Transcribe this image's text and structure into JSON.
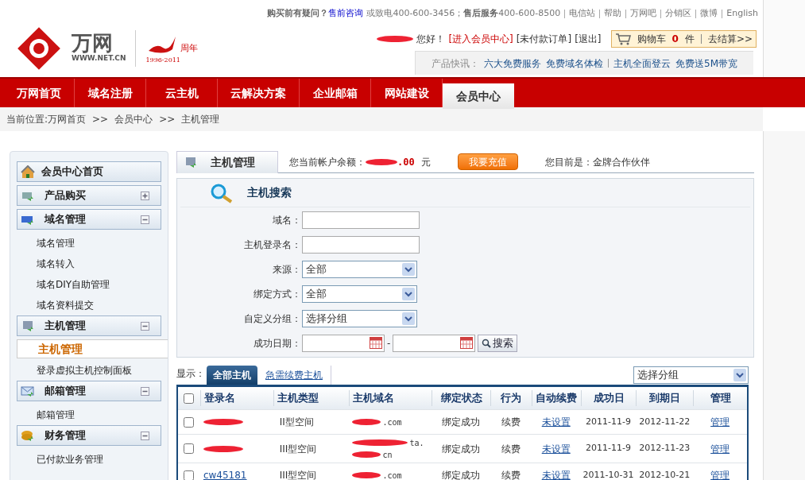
{
  "header": {
    "help_prefix": "购买前有疑问？",
    "presale": "售前咨询",
    "phone1": "或致电400-600-3456；",
    "aftersale": "售后服务",
    "phone2": "400-600-8500",
    "top_links": [
      "电信站",
      "帮助",
      "万网吧",
      "分销区",
      "微博",
      "English"
    ],
    "logo_text": "万网",
    "logo_url": "WWW.NET.CN",
    "anniv_years": "1996-2011",
    "anniv_label": "周年",
    "greeting": "您好！",
    "member_link": "[进入会员中心]",
    "unpaid": "[未付款订单]",
    "logout": "[退出]",
    "cart_label": "购物车",
    "cart_count": "0",
    "cart_unit": "件",
    "checkout": "去结算>>",
    "news_label": "产品快讯：",
    "news": [
      "六大免费服务",
      "免费域名体检",
      "主机全面登云",
      "免费送5M带宽"
    ]
  },
  "nav": [
    {
      "label": "万网首页",
      "selected": false
    },
    {
      "label": "域名注册",
      "selected": false
    },
    {
      "label": "云主机",
      "selected": false
    },
    {
      "label": "云解决方案",
      "selected": false
    },
    {
      "label": "企业邮箱",
      "selected": false
    },
    {
      "label": "网站建设",
      "selected": false
    },
    {
      "label": "会员中心",
      "selected": true
    }
  ],
  "breadcrumb": [
    "当前位置:万网首页",
    ">>",
    "会员中心",
    ">>",
    "主机管理"
  ],
  "sidebar": [
    {
      "label": "会员中心首页",
      "kind": "link"
    },
    {
      "label": "产品购买",
      "kind": "group",
      "expanded": false
    },
    {
      "label": "域名管理",
      "kind": "group",
      "expanded": true,
      "children": [
        {
          "label": "域名管理",
          "selected": false
        },
        {
          "label": "域名转入",
          "selected": false
        },
        {
          "label": "域名DIY自助管理",
          "selected": false
        },
        {
          "label": "域名资料提交",
          "selected": false
        }
      ]
    },
    {
      "label": "主机管理",
      "kind": "group",
      "expanded": true,
      "children": [
        {
          "label": "主机管理",
          "selected": true
        },
        {
          "label": "登录虚拟主机控制面板",
          "selected": false
        }
      ]
    },
    {
      "label": "邮箱管理",
      "kind": "group",
      "expanded": true,
      "children": [
        {
          "label": "邮箱管理",
          "selected": false
        }
      ]
    },
    {
      "label": "财务管理",
      "kind": "group",
      "expanded": true,
      "children": [
        {
          "label": "已付款业务管理",
          "selected": false
        }
      ]
    }
  ],
  "main": {
    "title": "主机管理",
    "balance_label": "您当前帐户余额：",
    "balance": ".00",
    "currency": "元",
    "recharge": "我要充值",
    "level_label": "您目前是：金牌合作伙伴",
    "search_title": "主机搜索",
    "fields": [
      {
        "label": "域名：",
        "kind": "text"
      },
      {
        "label": "主机登录名：",
        "kind": "text"
      },
      {
        "label": "来源：",
        "kind": "select",
        "value": "全部"
      },
      {
        "label": "绑定方式：",
        "kind": "select",
        "value": "全部"
      },
      {
        "label": "自定义分组：",
        "kind": "select",
        "value": "选择分组"
      },
      {
        "label": "成功日期：",
        "kind": "daterange",
        "separator": "-"
      }
    ],
    "search_button": "搜索",
    "show_label": "显示：",
    "tabs": [
      {
        "label": "全部主机",
        "selected": true
      },
      {
        "label": "急需续费主机",
        "selected": false
      }
    ],
    "group_select": "选择分组",
    "table": {
      "all_checked": false,
      "columns": [
        "登录名",
        "主机类型",
        "主机域名",
        "绑定状态",
        "行为",
        "自动续费",
        "成功日",
        "到期日",
        "管理"
      ],
      "rows": [
        {
          "checked": false,
          "type": "II型空间",
          "domain": [
            ".com"
          ],
          "status": "绑定成功",
          "action": "续费",
          "auto": "未设置",
          "start": "2011-11-9",
          "end": "2012-11-22",
          "manage": "管理"
        },
        {
          "checked": false,
          "type": "III型空间",
          "domain": [
            "ta.",
            "cn"
          ],
          "status": "绑定成功",
          "action": "续费",
          "auto": "未设置",
          "start": "2011-11-9",
          "end": "2012-11-23",
          "manage": "管理"
        },
        {
          "checked": false,
          "login": "cw45181",
          "type": "III型空间",
          "domain": [
            ".com"
          ],
          "status": "绑定成功",
          "action": "续费",
          "auto": "未设置",
          "start": "2011-10-31",
          "end": "2012-10-21",
          "manage": "管理"
        }
      ]
    }
  }
}
